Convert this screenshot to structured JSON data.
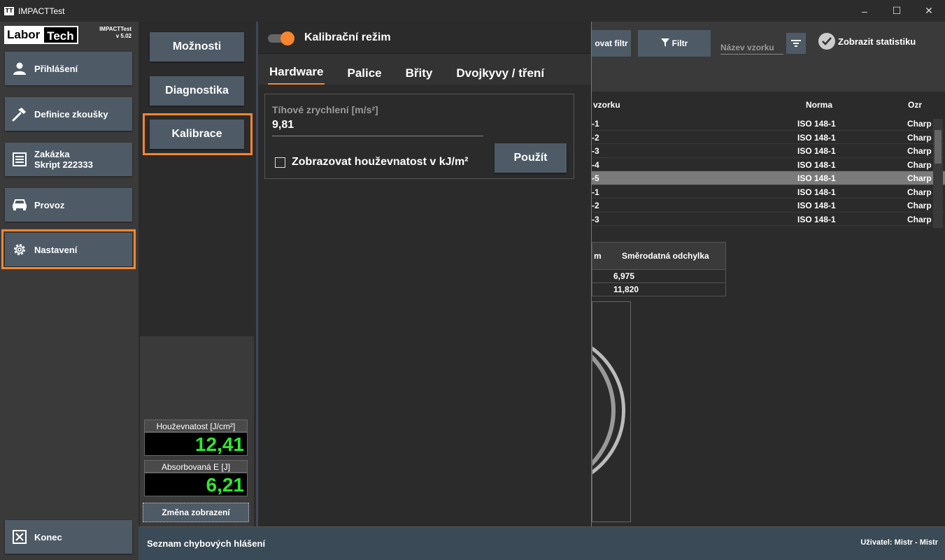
{
  "window": {
    "title": "IMPACTTest",
    "icon_text": "TT"
  },
  "logo": {
    "left": "Labor",
    "right": "Tech"
  },
  "version": {
    "app": "IMPACTTest",
    "ver": "v 5.02"
  },
  "nav": {
    "login": "Přihlášení",
    "test_def": "Definice zkoušky",
    "order_line1": "Zakázka",
    "order_line2": "Skript 222333",
    "operation": "Provoz",
    "settings": "Nastavení",
    "exit": "Konec"
  },
  "submenu": {
    "options": "Možnosti",
    "diagnostics": "Diagnostika",
    "calibration": "Kalibrace"
  },
  "meters": {
    "toughness_label": "Houževnatost [J/cm²]",
    "toughness_value": "12,41",
    "energy_label": "Absorbovaná E [J]",
    "energy_value": "6,21",
    "change_view": "Změna zobrazení"
  },
  "calib": {
    "mode_label": "Kalibrační režim",
    "mode_on": true,
    "tabs": [
      "Hardware",
      "Palice",
      "Břity",
      "Dvojkyvy / tření"
    ],
    "active_tab": "Hardware",
    "gravity_label": "Tíhové zrychlení [m/s²]",
    "gravity_value": "9,81",
    "show_kj_label": "Zobrazovat houževnatost v kJ/m²",
    "apply": "Použít"
  },
  "right_top": {
    "cancel_filter": "ovat filtr",
    "filter": "Filtr",
    "name_placeholder": "Název vzorku",
    "show_stats": "Zobrazit statistiku"
  },
  "table": {
    "headers": {
      "sample": "vzorku",
      "norm": "Norma",
      "mark": "Ozr"
    },
    "rows": [
      {
        "sample": "-1",
        "norm": "ISO 148-1",
        "mark": "Charp"
      },
      {
        "sample": "-2",
        "norm": "ISO 148-1",
        "mark": "Charp"
      },
      {
        "sample": "-3",
        "norm": "ISO 148-1",
        "mark": "Charp"
      },
      {
        "sample": "-4",
        "norm": "ISO 148-1",
        "mark": "Charp"
      },
      {
        "sample": "-5",
        "norm": "ISO 148-1",
        "mark": "Charp"
      },
      {
        "sample": "-1",
        "norm": "ISO 148-1",
        "mark": "Charp"
      },
      {
        "sample": "-2",
        "norm": "ISO 148-1",
        "mark": "Charp"
      },
      {
        "sample": "-3",
        "norm": "ISO 148-1",
        "mark": "Charp"
      }
    ],
    "selected_row": 4
  },
  "stats_table": {
    "col1": "m",
    "col2": "Směrodatná odchylka",
    "values": [
      "6,975",
      "11,820"
    ]
  },
  "status": {
    "errors": "Seznam chybových hlášení",
    "user": "Uživatel: Mistr  -  Mistr"
  },
  "colors": {
    "accent": "#f7862f",
    "button": "#4e5b66",
    "meter_green": "#2ee82e"
  }
}
